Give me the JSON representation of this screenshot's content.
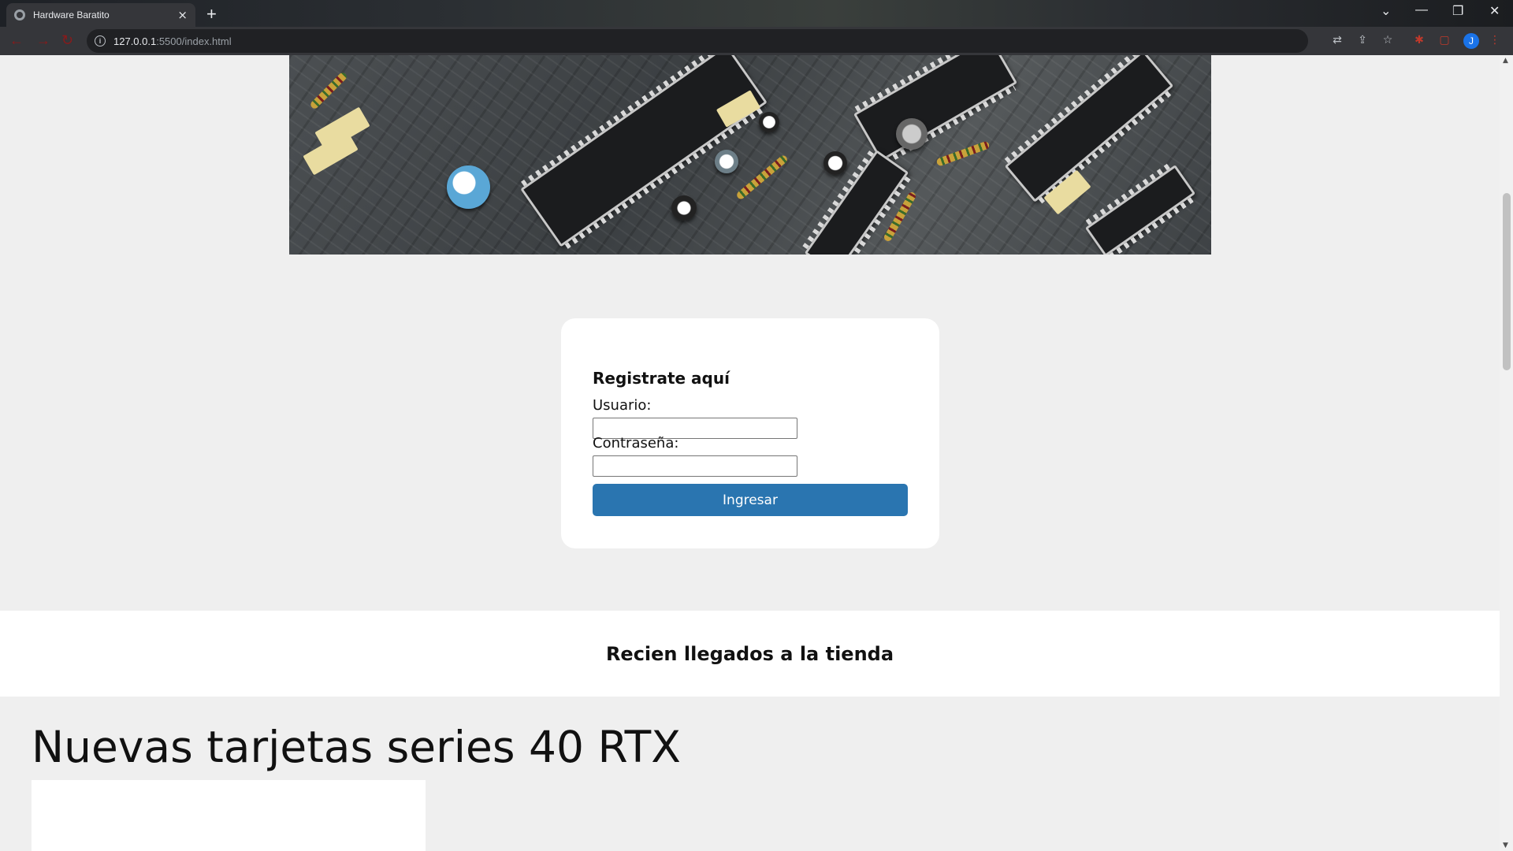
{
  "browser": {
    "tab_title": "Hardware Baratito",
    "tab_close": "×",
    "new_tab": "+",
    "url_host": "127.0.0.1",
    "url_path": ":5500/index.html",
    "profile_initial": "J",
    "window_controls": [
      "⌄",
      "—",
      "❐",
      "✕"
    ]
  },
  "login": {
    "heading": "Registrate aquí",
    "user_label": "Usuario:",
    "user_value": "",
    "password_label": "Contraseña:",
    "password_value": "",
    "submit_label": "Ingresar"
  },
  "recent": {
    "heading": "Recien llegados a la tienda"
  },
  "section": {
    "title": "Nuevas tarjetas series 40 RTX"
  },
  "colors": {
    "page_bg": "#efefef",
    "card_bg": "#ffffff",
    "button_bg": "#2a75b0",
    "chrome_bg": "#35363a"
  },
  "icons": [
    "globe-icon",
    "close-icon",
    "plus-icon",
    "back-icon",
    "forward-icon",
    "reload-icon",
    "info-icon",
    "translate-icon",
    "share-icon",
    "star-icon",
    "extensions-icon",
    "sidebar-icon",
    "menu-icon"
  ]
}
